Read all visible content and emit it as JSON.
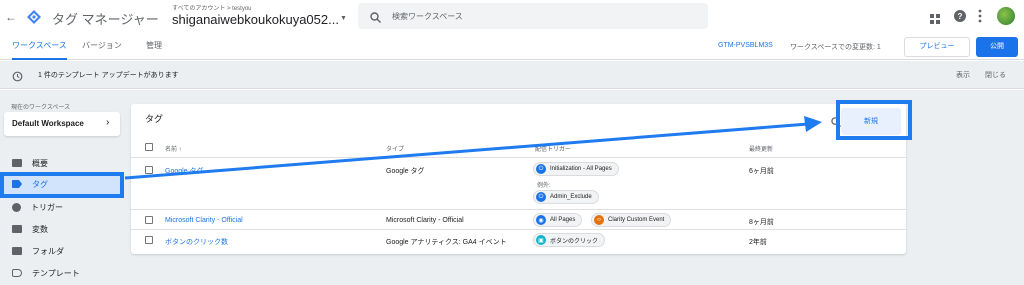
{
  "header": {
    "app_title": "タグ マネージャー",
    "breadcrumb": "すべてのアカウント > testyou",
    "container_name": "shiganaiwebkoukokuya052...",
    "search_placeholder": "検索ワークスペース"
  },
  "subnav": {
    "tabs": [
      "ワークスペース",
      "バージョン",
      "管理"
    ],
    "container_id": "GTM-PVSBLM3S",
    "changes_label": "ワークスペースでの変更数: 1",
    "preview_label": "プレビュー",
    "publish_label": "公開"
  },
  "banner": {
    "text": "1 件のテンプレート アップデートがあります",
    "show_label": "表示",
    "close_label": "閉じる"
  },
  "sidebar": {
    "workspace_label": "現在のワークスペース",
    "workspace_name": "Default Workspace",
    "items": [
      {
        "label": "概要",
        "icon": "overview-icon"
      },
      {
        "label": "タグ",
        "icon": "tag-icon"
      },
      {
        "label": "トリガー",
        "icon": "trigger-icon"
      },
      {
        "label": "変数",
        "icon": "variable-icon"
      },
      {
        "label": "フォルダ",
        "icon": "folder-icon"
      },
      {
        "label": "テンプレート",
        "icon": "template-icon"
      }
    ]
  },
  "card": {
    "title": "タグ",
    "new_button": "新規",
    "columns": [
      "名前 ↑",
      "タイプ",
      "配信トリガー",
      "最終更新"
    ],
    "rows": [
      {
        "name": "Google タグ",
        "type": "Google タグ",
        "triggers": [
          "Initialization - All Pages"
        ],
        "exception_label": "例外:",
        "exceptions": [
          "Admin_Exclude"
        ],
        "updated": "6ヶ月前"
      },
      {
        "name": "Microsoft Clarity - Official",
        "type": "Microsoft Clarity - Official",
        "triggers": [
          "All Pages",
          "Clarity Custom Event"
        ],
        "updated": "8ヶ月前"
      },
      {
        "name": "ボタンのクリック数",
        "type": "Google アナリティクス: GA4 イベント",
        "triggers": [
          "ボタンのクリック"
        ],
        "updated": "2年前"
      }
    ]
  },
  "colors": {
    "accent": "#1a73e8",
    "annotation": "#1e7bf0",
    "sidebar_active": "#d2e3fc"
  }
}
